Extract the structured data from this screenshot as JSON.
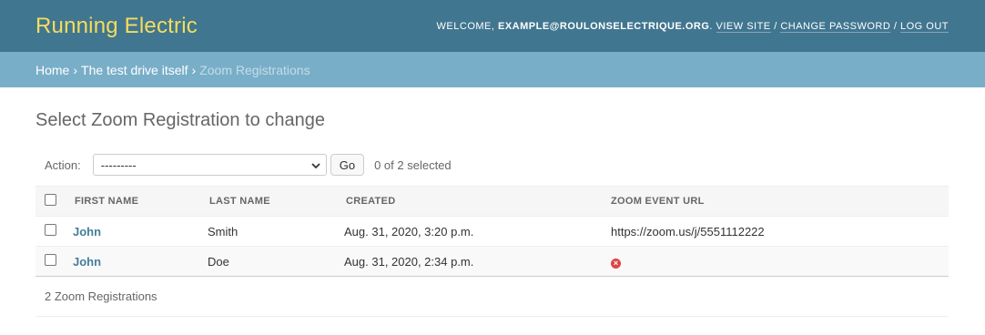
{
  "header": {
    "brand": "Running Electric",
    "welcome": "WELCOME, ",
    "user": "EXAMPLE@ROULONSELECTRIQUE.ORG",
    "view_site": "VIEW SITE",
    "change_password": "CHANGE PASSWORD",
    "log_out": "LOG OUT"
  },
  "breadcrumbs": {
    "home": "Home",
    "section": "The test drive itself",
    "current": "Zoom Registrations",
    "separator": "›"
  },
  "page_title": "Select Zoom Registration to change",
  "actions": {
    "label": "Action:",
    "select_value": "---------",
    "go": "Go",
    "counter": "0 of 2 selected"
  },
  "table": {
    "columns": [
      "FIRST NAME",
      "LAST NAME",
      "CREATED",
      "ZOOM EVENT URL"
    ],
    "rows": [
      {
        "first": "John",
        "last": "Smith",
        "created": "Aug. 31, 2020, 3:20 p.m.",
        "zoom": "https://zoom.us/j/5551112222",
        "zoom_missing": false
      },
      {
        "first": "John",
        "last": "Doe",
        "created": "Aug. 31, 2020, 2:34 p.m.",
        "zoom": "",
        "zoom_missing": true
      }
    ]
  },
  "paginator": "2 Zoom Registrations",
  "colors": {
    "header_bg": "#417690",
    "brand": "#f5dd5d",
    "breadcrumbs_bg": "#79aec8",
    "link": "#447e9b",
    "error_icon": "#dd4646"
  },
  "icons": {
    "missing_value": "x-circle-icon",
    "dropdown": "chevron-down-icon"
  }
}
